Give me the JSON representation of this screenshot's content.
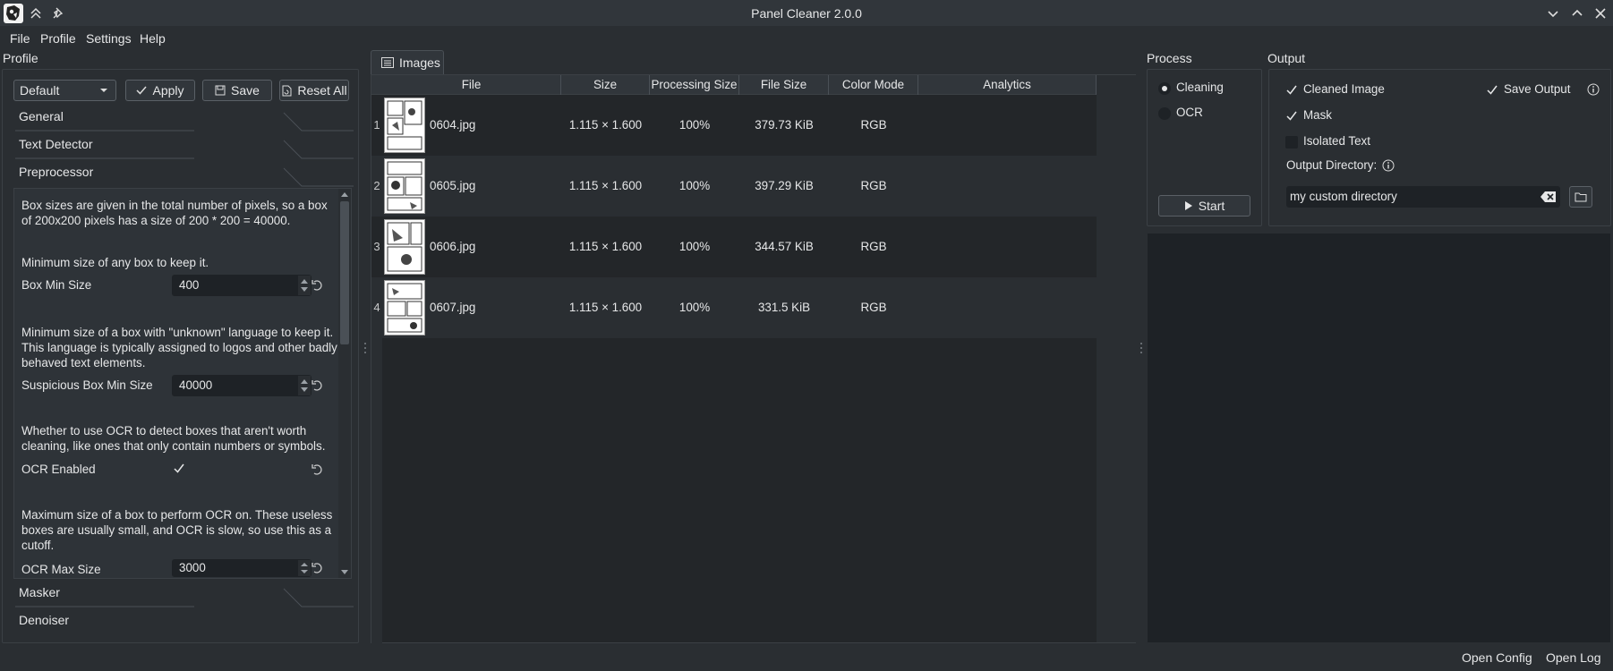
{
  "window": {
    "title": "Panel Cleaner 2.0.0"
  },
  "menu": {
    "file": "File",
    "profile": "Profile",
    "settings": "Settings",
    "help": "Help"
  },
  "left": {
    "group_label": "Profile",
    "profile_select": "Default",
    "apply": "Apply",
    "save": "Save",
    "reset_all": "Reset All",
    "tabs": {
      "general": "General",
      "text_detector": "Text Detector",
      "preprocessor": "Preprocessor",
      "masker": "Masker",
      "denoiser": "Denoiser"
    },
    "preprocessor": {
      "desc_intro": "Box sizes are given in the total number of pixels, so a box of 200x200 pixels has a size of 200 * 200 = 40000.",
      "desc_box_min": "Minimum size of any box to keep it.",
      "box_min_label": "Box Min Size",
      "box_min_value": "400",
      "desc_suspicious": "Minimum size of a box with \"unknown\" language to keep it. This language is typically assigned to logos and other badly behaved text elements.",
      "suspicious_label": "Suspicious Box Min Size",
      "suspicious_value": "40000",
      "desc_ocr": "Whether to use OCR to detect boxes that aren't worth cleaning, like ones that only contain numbers or symbols.",
      "ocr_enabled_label": "OCR Enabled",
      "ocr_enabled": true,
      "desc_ocr_max": "Maximum size of a box to perform OCR on. These useless boxes are usually small, and OCR is slow, so use this as a cutoff.",
      "ocr_max_label": "OCR Max Size",
      "ocr_max_value": "3000"
    }
  },
  "center": {
    "tab_label": "Images",
    "columns": [
      "File",
      "Size",
      "Processing Size",
      "File Size",
      "Color Mode",
      "Analytics"
    ],
    "rows": [
      {
        "num": "1",
        "file": "0604.jpg",
        "size": "1.115 × 1.600",
        "proc": "100%",
        "filesize": "379.73 KiB",
        "mode": "RGB",
        "analytics": ""
      },
      {
        "num": "2",
        "file": "0605.jpg",
        "size": "1.115 × 1.600",
        "proc": "100%",
        "filesize": "397.29 KiB",
        "mode": "RGB",
        "analytics": ""
      },
      {
        "num": "3",
        "file": "0606.jpg",
        "size": "1.115 × 1.600",
        "proc": "100%",
        "filesize": "344.57 KiB",
        "mode": "RGB",
        "analytics": ""
      },
      {
        "num": "4",
        "file": "0607.jpg",
        "size": "1.115 × 1.600",
        "proc": "100%",
        "filesize": "331.5 KiB",
        "mode": "RGB",
        "analytics": ""
      }
    ]
  },
  "process": {
    "label": "Process",
    "cleaning": "Cleaning",
    "ocr": "OCR",
    "selected": "Cleaning",
    "start": "Start"
  },
  "output": {
    "label": "Output",
    "cleaned_image": "Cleaned Image",
    "cleaned_image_checked": true,
    "save_output": "Save Output",
    "save_output_checked": true,
    "mask": "Mask",
    "mask_checked": true,
    "isolated_text": "Isolated Text",
    "isolated_text_checked": false,
    "dir_label": "Output Directory:",
    "dir_value": "my custom directory"
  },
  "status": {
    "open_config": "Open Config",
    "open_log": "Open Log"
  },
  "colors": {
    "bg": "#2a2e32",
    "panel": "#31363b",
    "field": "#1e2226",
    "text": "#e6e7e8"
  }
}
